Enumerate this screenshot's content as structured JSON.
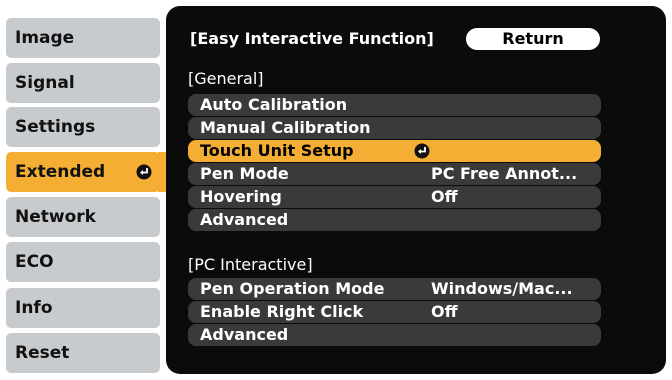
{
  "sidebar": {
    "items": [
      {
        "label": "Image"
      },
      {
        "label": "Signal"
      },
      {
        "label": "Settings"
      },
      {
        "label": "Extended",
        "active": true
      },
      {
        "label": "Network"
      },
      {
        "label": "ECO"
      },
      {
        "label": "Info"
      },
      {
        "label": "Reset"
      }
    ]
  },
  "panel": {
    "title": "[Easy Interactive Function]",
    "return_label": "Return",
    "sections": [
      {
        "header": "[General]",
        "rows": [
          {
            "label": "Auto Calibration",
            "value": ""
          },
          {
            "label": "Manual Calibration",
            "value": ""
          },
          {
            "label": "Touch Unit Setup",
            "value": "",
            "selected": true
          },
          {
            "label": "Pen Mode",
            "value": "PC Free Annot..."
          },
          {
            "label": "Hovering",
            "value": "Off"
          },
          {
            "label": "Advanced",
            "value": ""
          }
        ]
      },
      {
        "header": "[PC Interactive]",
        "rows": [
          {
            "label": "Pen Operation Mode",
            "value": "Windows/Mac..."
          },
          {
            "label": "Enable Right Click",
            "value": "Off"
          },
          {
            "label": "Advanced",
            "value": ""
          }
        ]
      }
    ]
  },
  "colors": {
    "accent": "#f3ae33",
    "sidebar_bg": "#c8cbce",
    "panel_bg": "#0b0b0b",
    "row_bg": "#3a3a3a"
  },
  "icons": {
    "enter": "enter-icon"
  }
}
